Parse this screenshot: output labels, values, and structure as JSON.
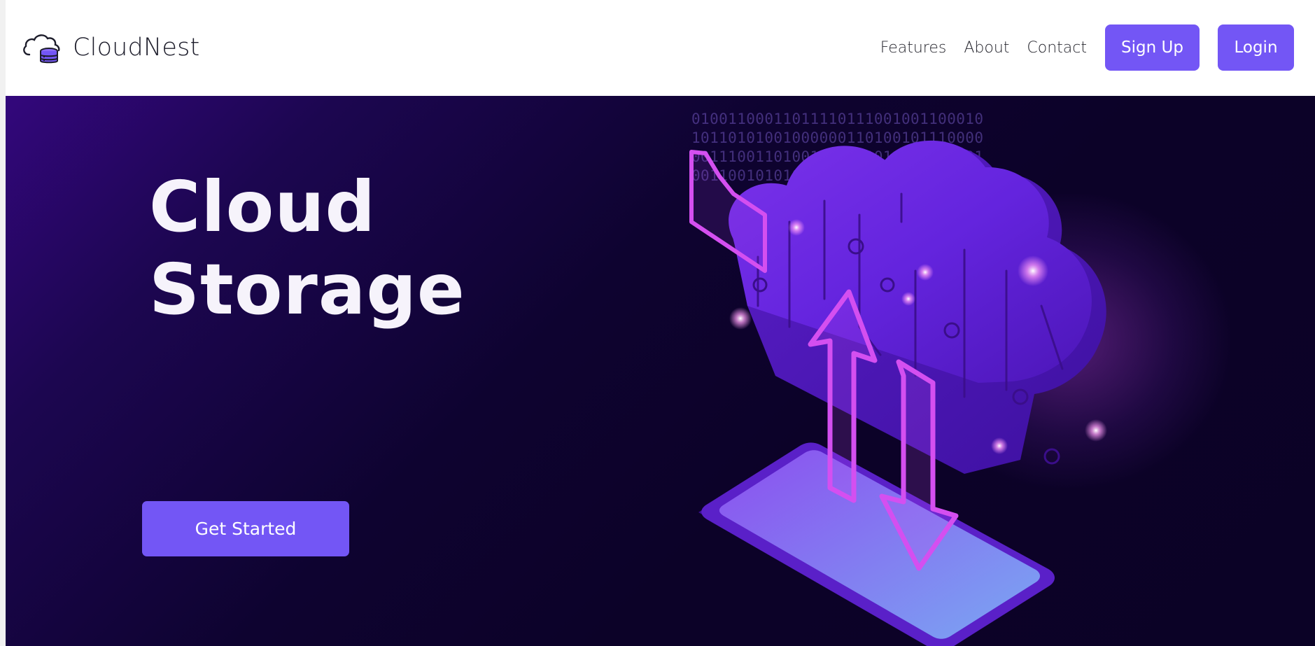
{
  "brand": {
    "name": "CloudNest",
    "logo_icon": "cloud-database-icon"
  },
  "nav": {
    "links": [
      "Features",
      "About",
      "Contact"
    ],
    "signup_label": "Sign Up",
    "login_label": "Login"
  },
  "hero": {
    "title_line1": "Cloud",
    "title_line2": "Storage",
    "cta_label": "Get Started",
    "illustration": "cloud-upload-download-icon",
    "binary_lines": [
      "01001100011011110111001001100010",
      "10110101001000000110100101110000",
      "00111001101001100011011110111001",
      "00110010101000110100110101111010"
    ]
  },
  "colors": {
    "accent": "#7356f5",
    "hero_bg_dark": "#0c0228",
    "hero_bg_light": "#33077c",
    "magenta": "#d14ef2"
  }
}
